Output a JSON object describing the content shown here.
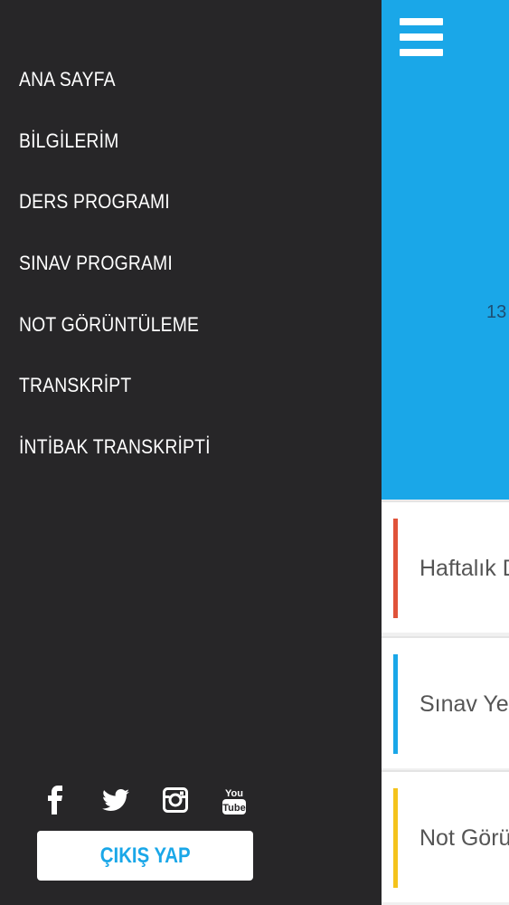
{
  "drawer": {
    "menu_items": [
      {
        "label": "ANA SAYFA"
      },
      {
        "label": "BİLGİLERİM"
      },
      {
        "label": "DERS PROGRAMI"
      },
      {
        "label": "SINAV PROGRAMI"
      },
      {
        "label": "NOT GÖRÜNTÜLEME"
      },
      {
        "label": "TRANSKRİPT"
      },
      {
        "label": "İNTİBAK TRANSKRİPTİ"
      }
    ],
    "social_icons": [
      "facebook-icon",
      "twitter-icon",
      "instagram-icon",
      "youtube-icon"
    ],
    "youtube_text_top": "You",
    "youtube_text_bottom": "Tube",
    "logout_label": "ÇIKIŞ YAP"
  },
  "main": {
    "date_fragment": "13",
    "cards": [
      {
        "label": "Haftalık De",
        "color": "#e0533a"
      },
      {
        "label": "Sınav Yeri",
        "color": "#1aa7e8"
      },
      {
        "label": "Not Görün",
        "color": "#f4c31c"
      }
    ]
  },
  "colors": {
    "drawer_bg": "#272628",
    "header_bg": "#1aa7e8",
    "accent": "#1aa7e8"
  }
}
